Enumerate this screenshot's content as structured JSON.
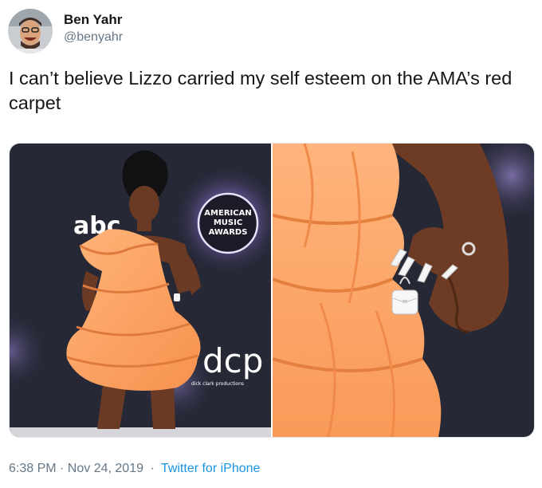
{
  "tweet": {
    "author": {
      "name": "Ben Yahr",
      "handle": "@benyahr"
    },
    "text": "I can’t believe Lizzo carried my self esteem on the AMA’s red carpet",
    "media": [
      {
        "backdrop_text": [
          "abc",
          "AMERICAN",
          "MUSIC",
          "AWARDS",
          "dcp",
          "dick clark productions"
        ]
      },
      {}
    ],
    "timestamp": "6:38 PM · Nov 24, 2019",
    "separator": "·",
    "source": "Twitter for iPhone"
  },
  "colors": {
    "dress": "#ffa96a",
    "backdrop": "#262836",
    "link": "#1b95e0",
    "secondary_text": "#657786"
  }
}
